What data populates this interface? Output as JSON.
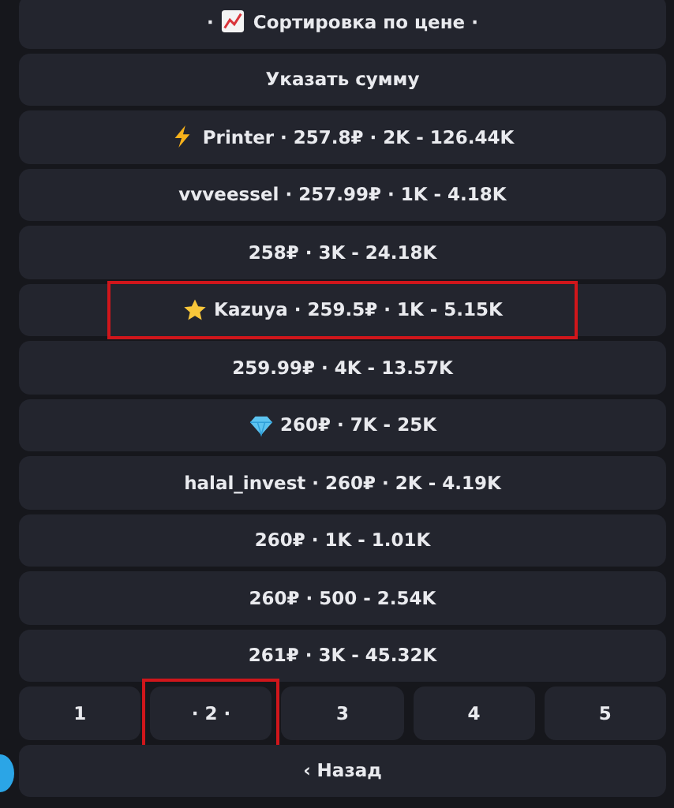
{
  "sort_button": {
    "prefix": "·",
    "label": "Сортировка по цене ·"
  },
  "amount_button": {
    "label": "Указать сумму"
  },
  "offers": [
    {
      "kind": "lightning",
      "label": "Printer · 257.8₽ · 2K - 126.44K",
      "highlighted": false
    },
    {
      "kind": "plain",
      "label": "vvveessel · 257.99₽ · 1K - 4.18K",
      "highlighted": false
    },
    {
      "kind": "plain",
      "label": "258₽ · 3K - 24.18K",
      "highlighted": false
    },
    {
      "kind": "star",
      "label": "Kazuya · 259.5₽ · 1K - 5.15K",
      "highlighted": true
    },
    {
      "kind": "plain",
      "label": "259.99₽ · 4K - 13.57K",
      "highlighted": false
    },
    {
      "kind": "diamond",
      "label": "260₽ · 7K - 25K",
      "highlighted": false
    },
    {
      "kind": "plain",
      "label": "halal_invest · 260₽ · 2K - 4.19K",
      "highlighted": false
    },
    {
      "kind": "plain",
      "label": "260₽ · 1K - 1.01K",
      "highlighted": false
    },
    {
      "kind": "plain",
      "label": "260₽ · 500 - 2.54K",
      "highlighted": false
    },
    {
      "kind": "plain",
      "label": "261₽ · 3K - 45.32K",
      "highlighted": false
    }
  ],
  "pages": [
    {
      "label": "1",
      "highlighted": false
    },
    {
      "label": "· 2 ·",
      "highlighted": true
    },
    {
      "label": "3",
      "highlighted": false
    },
    {
      "label": "4",
      "highlighted": false
    },
    {
      "label": "5",
      "highlighted": false
    }
  ],
  "back_button": {
    "label": "‹ Назад"
  }
}
